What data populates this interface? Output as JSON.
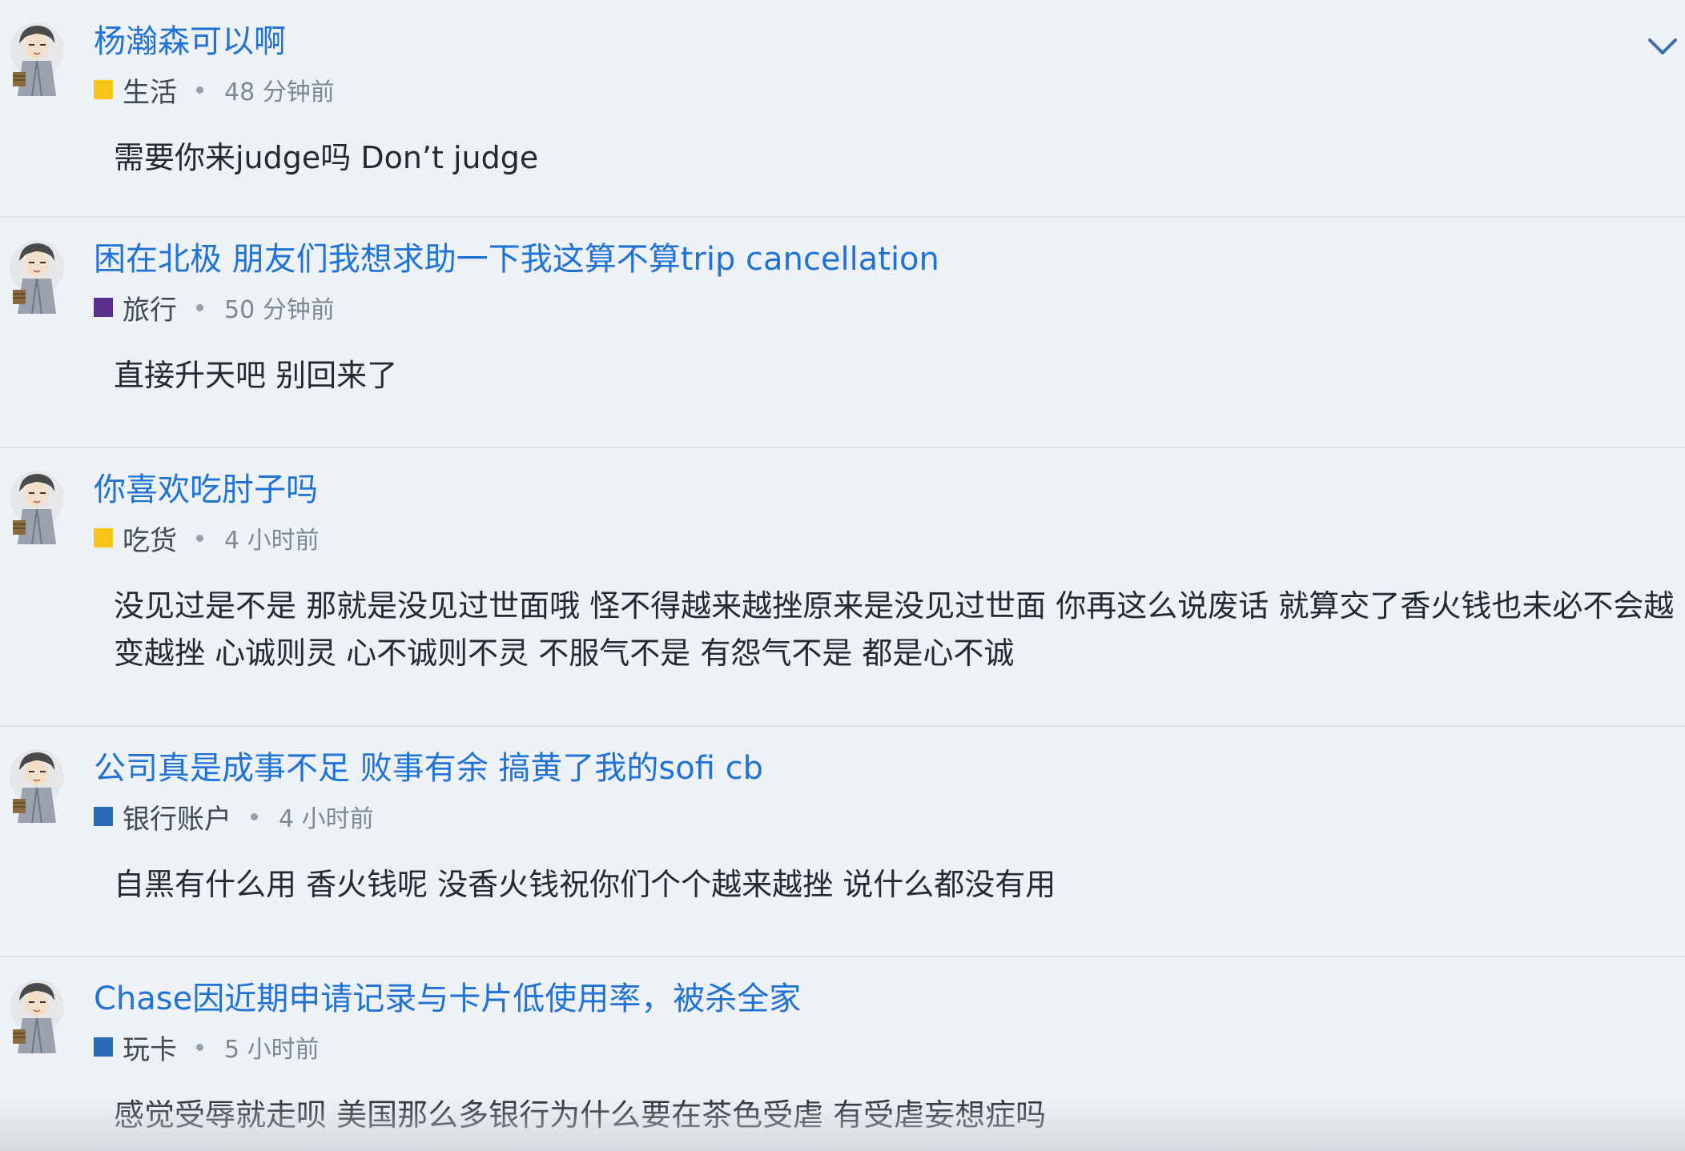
{
  "feed": {
    "items": [
      {
        "title": "杨瀚森可以啊",
        "category": "生活",
        "category_color": "#f5c518",
        "time": "48 分钟前",
        "excerpt": "需要你来judge吗 Don’t judge",
        "avatar": "ink-sketch-person-avatar"
      },
      {
        "title": "困在北极 朋友们我想求助一下我这算不算trip cancellation",
        "category": "旅行",
        "category_color": "#5b2d8c",
        "time": "50 分钟前",
        "excerpt": "直接升天吧 别回来了",
        "avatar": "ink-sketch-person-avatar"
      },
      {
        "title": "你喜欢吃肘子吗",
        "category": "吃货",
        "category_color": "#f5c518",
        "time": "4 小时前",
        "excerpt": "没见过是不是 那就是没见过世面哦 怪不得越来越挫原来是没见过世面 你再这么说废话 就算交了香火钱也未必不会越变越挫 心诚则灵 心不诚则不灵 不服气不是 有怨气不是 都是心不诚",
        "avatar": "ink-sketch-person-avatar"
      },
      {
        "title": "公司真是成事不足 败事有余 搞黄了我的sofi cb",
        "category": "银行账户",
        "category_color": "#2869b8",
        "time": "4 小时前",
        "excerpt": "自黑有什么用 香火钱呢 没香火钱祝你们个个越来越挫 说什么都没有用",
        "avatar": "ink-sketch-person-avatar"
      },
      {
        "title": "Chase因近期申请记录与卡片低使用率，被杀全家",
        "category": "玩卡",
        "category_color": "#2869b8",
        "time": "5 小时前",
        "excerpt": "感觉受辱就走呗 美国那么多银行为什么要在茶色受虐 有受虐妄想症吗",
        "avatar": "ink-sketch-person-avatar"
      }
    ],
    "collapse_icon": "chevron-down-icon"
  }
}
